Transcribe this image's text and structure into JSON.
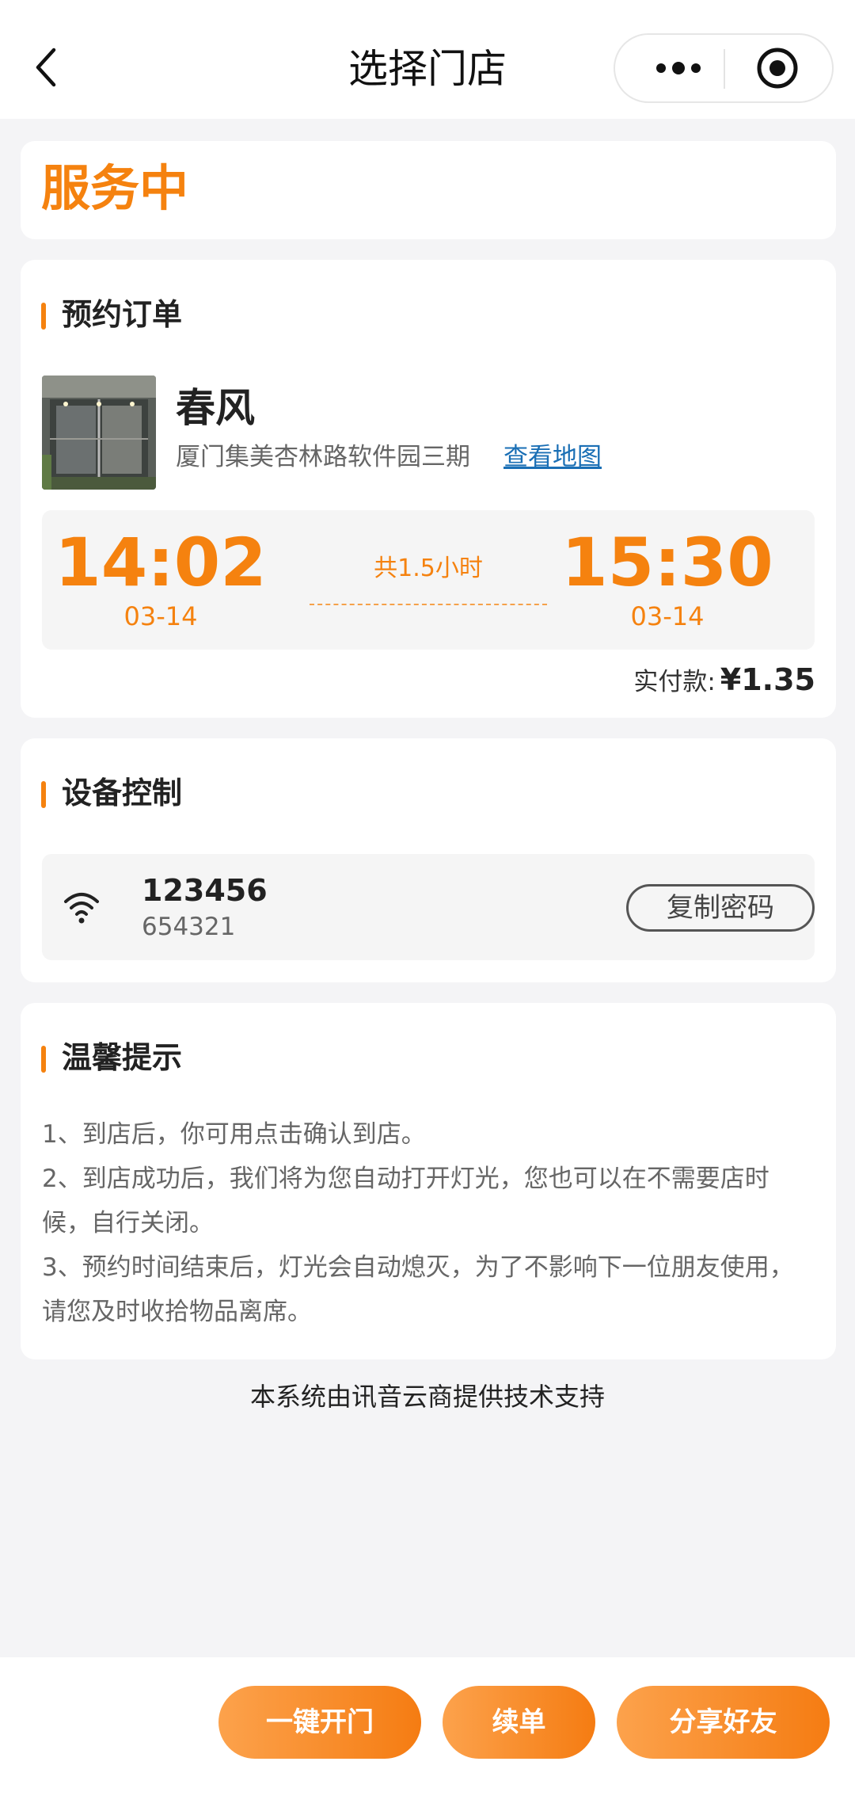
{
  "nav": {
    "title": "选择门店"
  },
  "status": {
    "text": "服务中"
  },
  "order": {
    "section_title": "预约订单",
    "store_name": "春风",
    "address": "厦门集美杏林路软件园三期",
    "map_link": "查看地图",
    "start_time": "14:02",
    "start_date": "03-14",
    "duration": "共1.5小时",
    "end_time": "15:30",
    "end_date": "03-14",
    "paid_label": "实付款:",
    "paid_amount": "¥1.35"
  },
  "device": {
    "section_title": "设备控制",
    "wifi_name": "123456",
    "wifi_password": "654321",
    "copy_button": "复制密码"
  },
  "tips": {
    "section_title": "温馨提示",
    "items": [
      "1、到店后，你可用点击确认到店。",
      "2、到店成功后，我们将为您自动打开灯光，您也可以在不需要店时候，自行关闭。",
      "3、预约时间结束后，灯光会自动熄灭，为了不影响下一位朋友使用，请您及时收拾物品离席。"
    ]
  },
  "footer_note": "本系统由讯音云商提供技术支持",
  "actions": {
    "open_door": "一键开门",
    "renew": "续单",
    "share": "分享好友"
  },
  "colors": {
    "accent": "#f5820f",
    "link": "#1a6fb5"
  }
}
